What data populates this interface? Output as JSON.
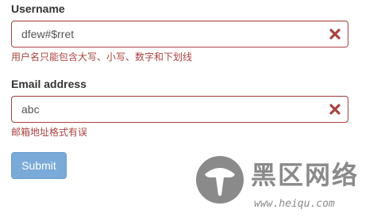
{
  "form": {
    "username": {
      "label": "Username",
      "value": "dfew#$rret",
      "error": "用户名只能包含大写、小写、数字和下划线"
    },
    "email": {
      "label": "Email address",
      "value": "abc",
      "error": "邮箱地址格式有误"
    },
    "submit_label": "Submit"
  },
  "watermark": {
    "title": "黑区网络",
    "url": "www.heiqu.com"
  },
  "icons": {
    "invalid_icon": "x-mark-icon",
    "watermark_logo": "mushroom-logo-icon"
  },
  "colors": {
    "error": "#a94442",
    "button": "#7aaad8",
    "label": "#333333",
    "watermark": "#8a8a8a"
  }
}
